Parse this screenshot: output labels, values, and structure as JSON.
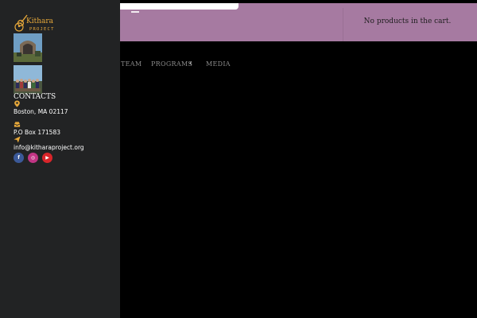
{
  "header": {
    "cart_text": "No products in the cart."
  },
  "nav": {
    "items": [
      "TEAM",
      "PROGRAMS",
      "MEDIA"
    ]
  },
  "sidebar": {
    "logo_text_1": "Kithara",
    "logo_text_2": "PROJECT",
    "contacts_title": "CONTACTS",
    "address": "Boston, MA 02117",
    "po_box": "P.O Box 171583",
    "email": "info@kitharaproject.org",
    "social": [
      {
        "icon": "facebook-icon",
        "glyph": "f",
        "color": "#3b5998"
      },
      {
        "icon": "instagram-icon",
        "glyph": "◎",
        "color": "#c13584"
      },
      {
        "icon": "youtube-icon",
        "glyph": "▶",
        "color": "#d9252a"
      }
    ]
  },
  "colors": {
    "header_bg": "#a67aa1",
    "sidebar_bg": "#222324",
    "accent": "#e8a93a"
  }
}
